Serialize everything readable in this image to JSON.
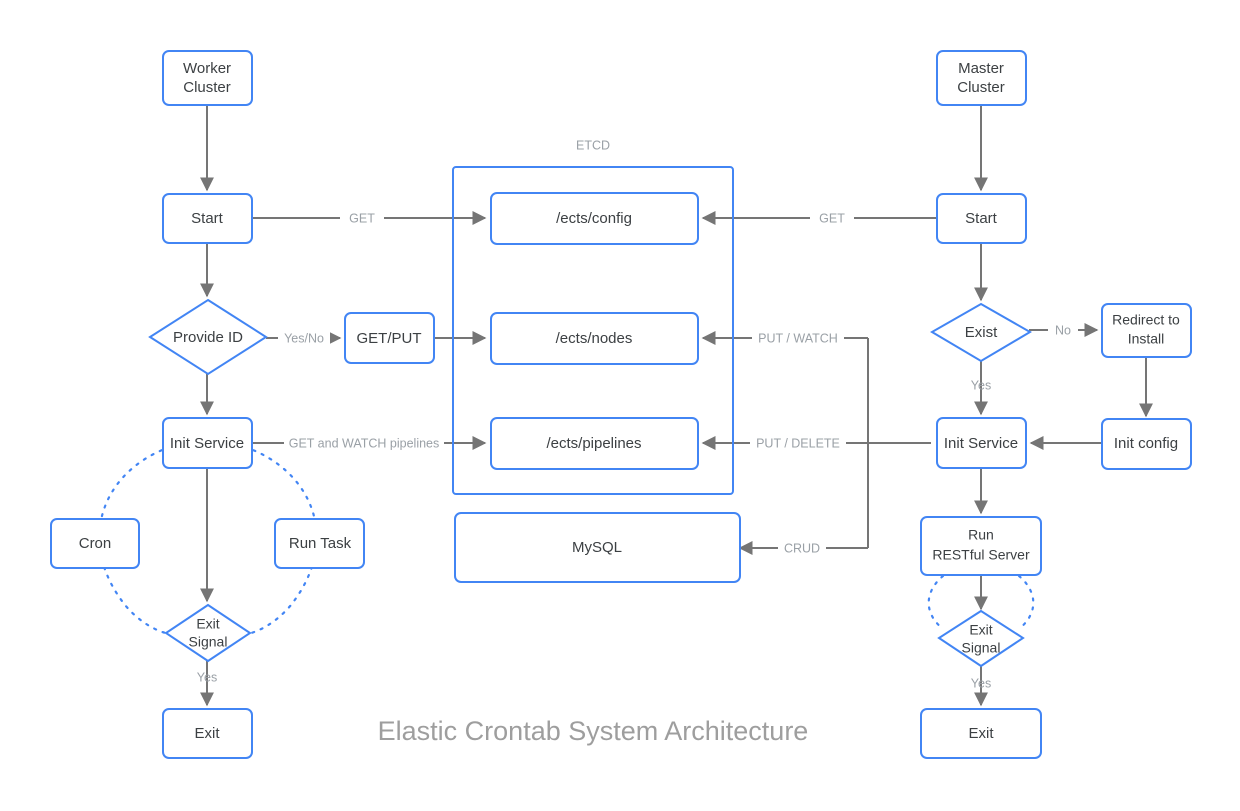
{
  "diagram": {
    "title": "Elastic Crontab System Architecture",
    "accent_color": "#4285f4",
    "edge_color": "#757575",
    "label_color": "#9aa0a6",
    "text_color": "#3c4043",
    "background": "#ffffff"
  },
  "groups": [
    {
      "id": "etcd",
      "label": "ETCD"
    }
  ],
  "nodes": {
    "worker_cluster": {
      "label_line1": "Worker",
      "label_line2": "Cluster",
      "shape": "rect"
    },
    "worker_start": {
      "label": "Start",
      "shape": "rect"
    },
    "provide_id": {
      "label": "Provide ID",
      "shape": "diamond"
    },
    "get_put": {
      "label": "GET/PUT",
      "shape": "rect"
    },
    "worker_init_service": {
      "label": "Init Service",
      "shape": "rect"
    },
    "cron": {
      "label": "Cron",
      "shape": "rect"
    },
    "run_task": {
      "label": "Run Task",
      "shape": "rect"
    },
    "worker_exit_signal": {
      "label_line1": "Exit",
      "label_line2": "Signal",
      "shape": "diamond"
    },
    "worker_exit": {
      "label": "Exit",
      "shape": "rect"
    },
    "ects_config": {
      "label": "/ects/config",
      "shape": "rect"
    },
    "ects_nodes": {
      "label": "/ects/nodes",
      "shape": "rect"
    },
    "ects_pipelines": {
      "label": "/ects/pipelines",
      "shape": "rect"
    },
    "mysql": {
      "label": "MySQL",
      "shape": "rect"
    },
    "master_cluster": {
      "label_line1": "Master",
      "label_line2": "Cluster",
      "shape": "rect"
    },
    "master_start": {
      "label": "Start",
      "shape": "rect"
    },
    "exist": {
      "label": "Exist",
      "shape": "diamond"
    },
    "redirect_to_install": {
      "label_line1": "Redirect to",
      "label_line2": "Install",
      "shape": "rect"
    },
    "master_init_service": {
      "label": "Init Service",
      "shape": "rect"
    },
    "init_config": {
      "label": "Init config",
      "shape": "rect"
    },
    "run_restful_server": {
      "label_line1": "Run",
      "label_line2": "RESTful Server",
      "shape": "rect"
    },
    "master_exit_signal": {
      "label_line1": "Exit",
      "label_line2": "Signal",
      "shape": "diamond"
    },
    "master_exit": {
      "label": "Exit",
      "shape": "rect"
    }
  },
  "edges": [
    {
      "id": "worker-cluster-to-start",
      "from": "worker_cluster",
      "to": "worker_start",
      "label": ""
    },
    {
      "id": "worker-start-to-config",
      "from": "worker_start",
      "to": "ects_config",
      "label": "GET"
    },
    {
      "id": "worker-start-to-provide-id",
      "from": "worker_start",
      "to": "provide_id",
      "label": ""
    },
    {
      "id": "provide-id-to-get-put",
      "from": "provide_id",
      "to": "get_put",
      "label": "Yes/No"
    },
    {
      "id": "get-put-to-nodes",
      "from": "get_put",
      "to": "ects_nodes",
      "label": ""
    },
    {
      "id": "provide-id-to-init-service",
      "from": "provide_id",
      "to": "worker_init_service",
      "label": ""
    },
    {
      "id": "worker-init-service-to-pipelines",
      "from": "worker_init_service",
      "to": "ects_pipelines",
      "label": "GET and WATCH pipelines"
    },
    {
      "id": "worker-init-service-to-exit-signal",
      "from": "worker_init_service",
      "to": "worker_exit_signal",
      "label": ""
    },
    {
      "id": "worker-init-service-to-cron",
      "from": "worker_init_service",
      "to": "cron",
      "label": "",
      "style": "dotted"
    },
    {
      "id": "worker-init-service-to-run-task",
      "from": "worker_init_service",
      "to": "run_task",
      "label": "",
      "style": "dotted"
    },
    {
      "id": "cron-to-exit-signal",
      "from": "cron",
      "to": "worker_exit_signal",
      "label": "",
      "style": "dotted"
    },
    {
      "id": "run-task-to-exit-signal",
      "from": "run_task",
      "to": "worker_exit_signal",
      "label": "",
      "style": "dotted"
    },
    {
      "id": "worker-exit-signal-to-exit",
      "from": "worker_exit_signal",
      "to": "worker_exit",
      "label": "Yes"
    },
    {
      "id": "master-cluster-to-start",
      "from": "master_cluster",
      "to": "master_start",
      "label": ""
    },
    {
      "id": "master-start-to-config",
      "from": "master_start",
      "to": "ects_config",
      "label": "GET"
    },
    {
      "id": "master-start-to-exist",
      "from": "master_start",
      "to": "exist",
      "label": ""
    },
    {
      "id": "exist-to-redirect",
      "from": "exist",
      "to": "redirect_to_install",
      "label": "No"
    },
    {
      "id": "exist-to-init-service",
      "from": "exist",
      "to": "master_init_service",
      "label": "Yes"
    },
    {
      "id": "redirect-to-init-config",
      "from": "redirect_to_install",
      "to": "init_config",
      "label": ""
    },
    {
      "id": "init-config-to-init-service",
      "from": "init_config",
      "to": "master_init_service",
      "label": ""
    },
    {
      "id": "master-init-service-to-nodes",
      "from": "master_init_service",
      "to": "ects_nodes",
      "label": "PUT / WATCH"
    },
    {
      "id": "master-init-service-to-pipelines",
      "from": "master_init_service",
      "to": "ects_pipelines",
      "label": "PUT / DELETE"
    },
    {
      "id": "master-init-service-to-mysql",
      "from": "master_init_service",
      "to": "mysql",
      "label": "CRUD"
    },
    {
      "id": "master-init-service-to-restful",
      "from": "master_init_service",
      "to": "run_restful_server",
      "label": ""
    },
    {
      "id": "restful-to-exit-signal",
      "from": "run_restful_server",
      "to": "master_exit_signal",
      "label": ""
    },
    {
      "id": "restful-to-exit-signal-left",
      "from": "run_restful_server",
      "to": "master_exit_signal",
      "label": "",
      "style": "dotted"
    },
    {
      "id": "restful-to-exit-signal-right",
      "from": "run_restful_server",
      "to": "master_exit_signal",
      "label": "",
      "style": "dotted"
    },
    {
      "id": "master-exit-signal-to-exit",
      "from": "master_exit_signal",
      "to": "master_exit",
      "label": "Yes"
    }
  ]
}
